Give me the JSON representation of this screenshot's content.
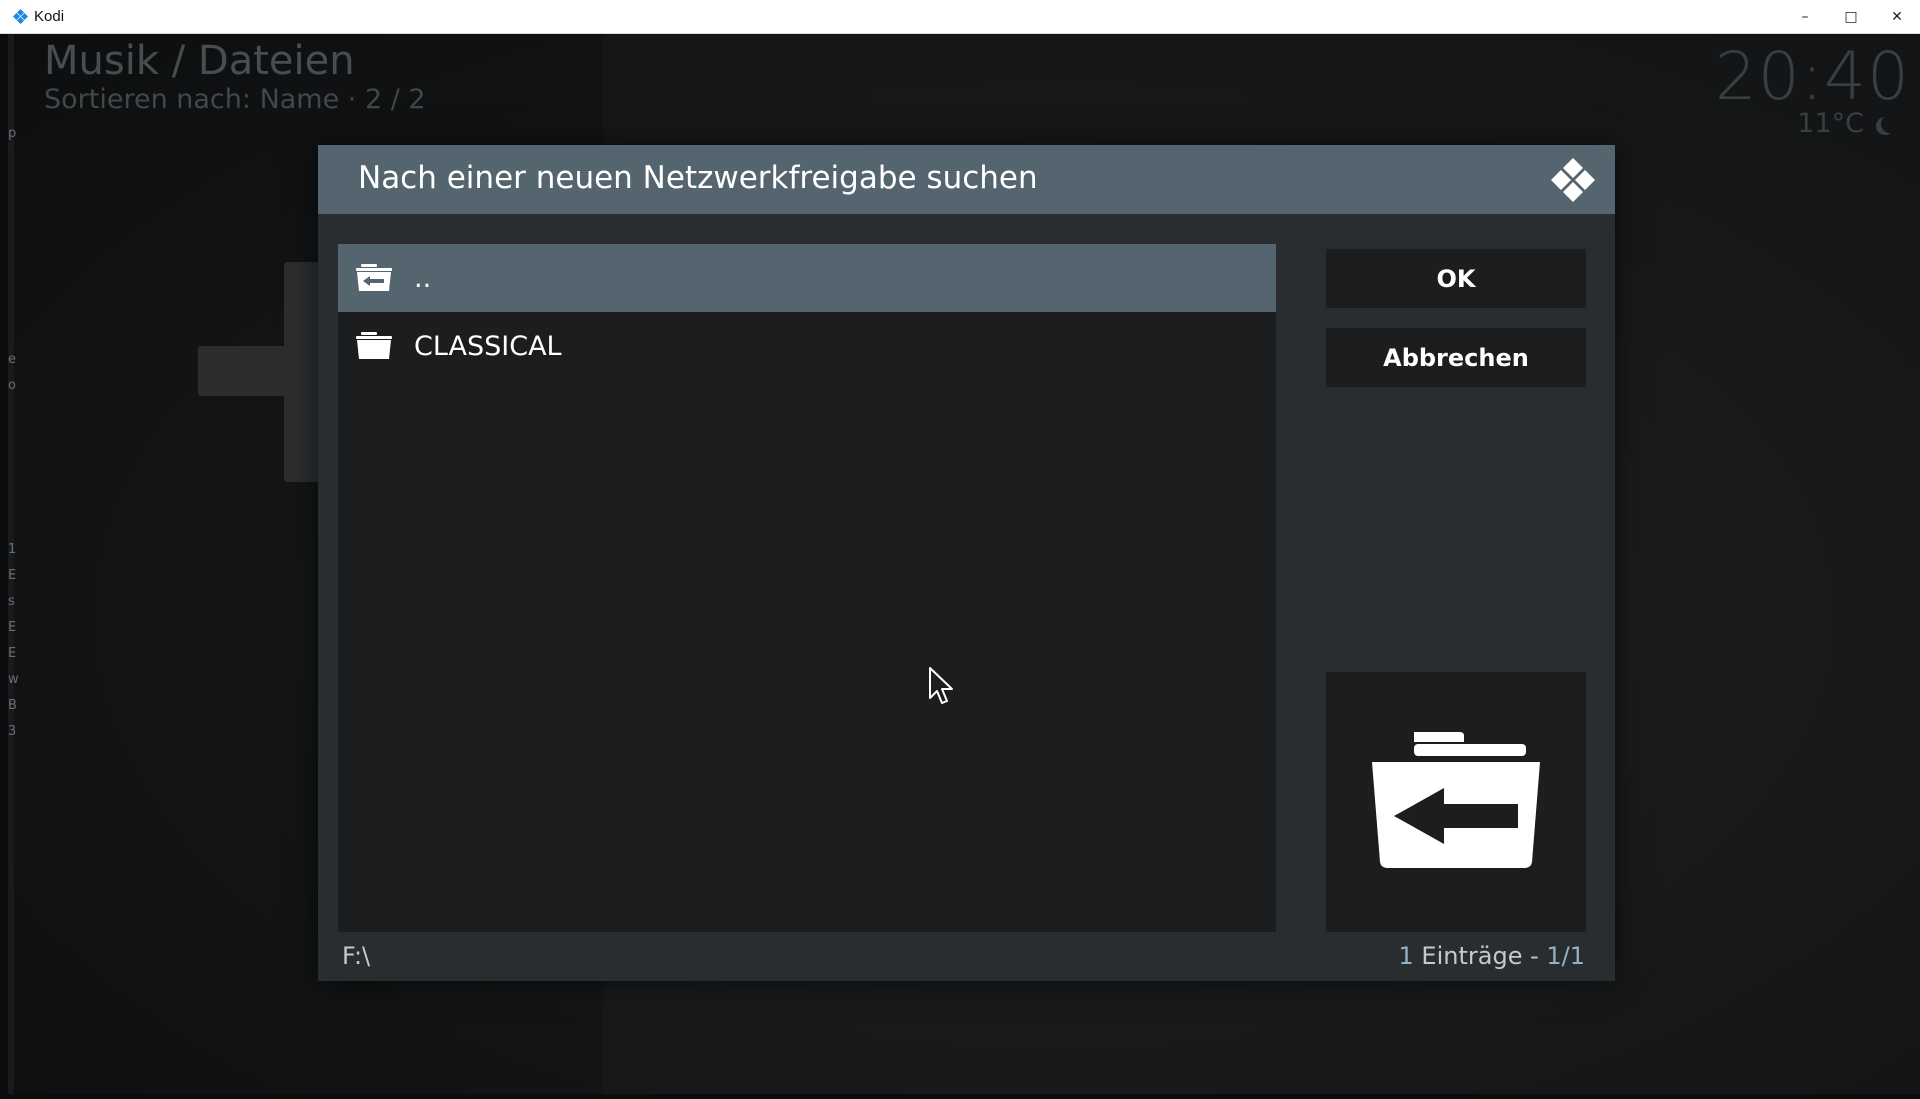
{
  "window": {
    "title": "Kodi",
    "controls": {
      "minimize": "–",
      "maximize": "□",
      "close": "✕"
    }
  },
  "background": {
    "title": "Musik / Dateien",
    "sort": "Sortieren nach: Name  ·  2 / 2",
    "clock": "20:40",
    "temperature": "11°C",
    "weather_icon": "moon-icon",
    "left_edge_letters": [
      "p",
      "e",
      "o",
      "1",
      "E",
      "s",
      "E",
      "E",
      "w",
      "B",
      "3"
    ]
  },
  "dialog": {
    "title": "Nach einer neuen Netzwerkfreigabe suchen",
    "logo_icon": "kodi-logo-icon",
    "items": [
      {
        "label": "..",
        "icon": "folder-back-icon",
        "selected": true
      },
      {
        "label": "CLASSICAL",
        "icon": "folder-icon",
        "selected": false
      }
    ],
    "buttons": {
      "ok": "OK",
      "cancel": "Abbrechen"
    },
    "preview_icon": "folder-back-icon",
    "footer": {
      "path": "F:\\",
      "count_number": "1",
      "count_label": " Einträge - ",
      "count_page": "1/1"
    }
  },
  "colors": {
    "header": "#546570",
    "dialog_body": "#2a2d30",
    "panel": "#1b1d1f",
    "selected_row": "#546570",
    "accent": "#8fb2c7"
  }
}
